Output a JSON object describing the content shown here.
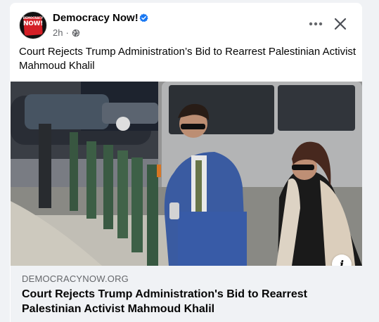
{
  "post": {
    "page_name": "Democracy Now!",
    "timestamp": "2h",
    "audience_icon": "globe-icon",
    "verified_icon": "verified-badge-icon",
    "text": "Court Rejects Trump Administration’s Bid to Rearrest Palestinian Activist Mahmoud Khalil",
    "avatar_text_small": "DEMOCRACY",
    "avatar_text": "NOW!"
  },
  "header_actions": {
    "more_icon": "more-options-icon",
    "close_icon": "close-icon"
  },
  "link_preview": {
    "domain": "DEMOCRACYNOW.ORG",
    "title": "Court Rejects Trump Administration's Bid to Rearrest Palestinian Activist Mahmoud Khalil",
    "info_label": "i"
  },
  "colors": {
    "brand_red": "#d41f26",
    "verified_blue": "#1877f2",
    "text_primary": "#050505",
    "text_secondary": "#65676b",
    "background": "#f0f2f5"
  }
}
